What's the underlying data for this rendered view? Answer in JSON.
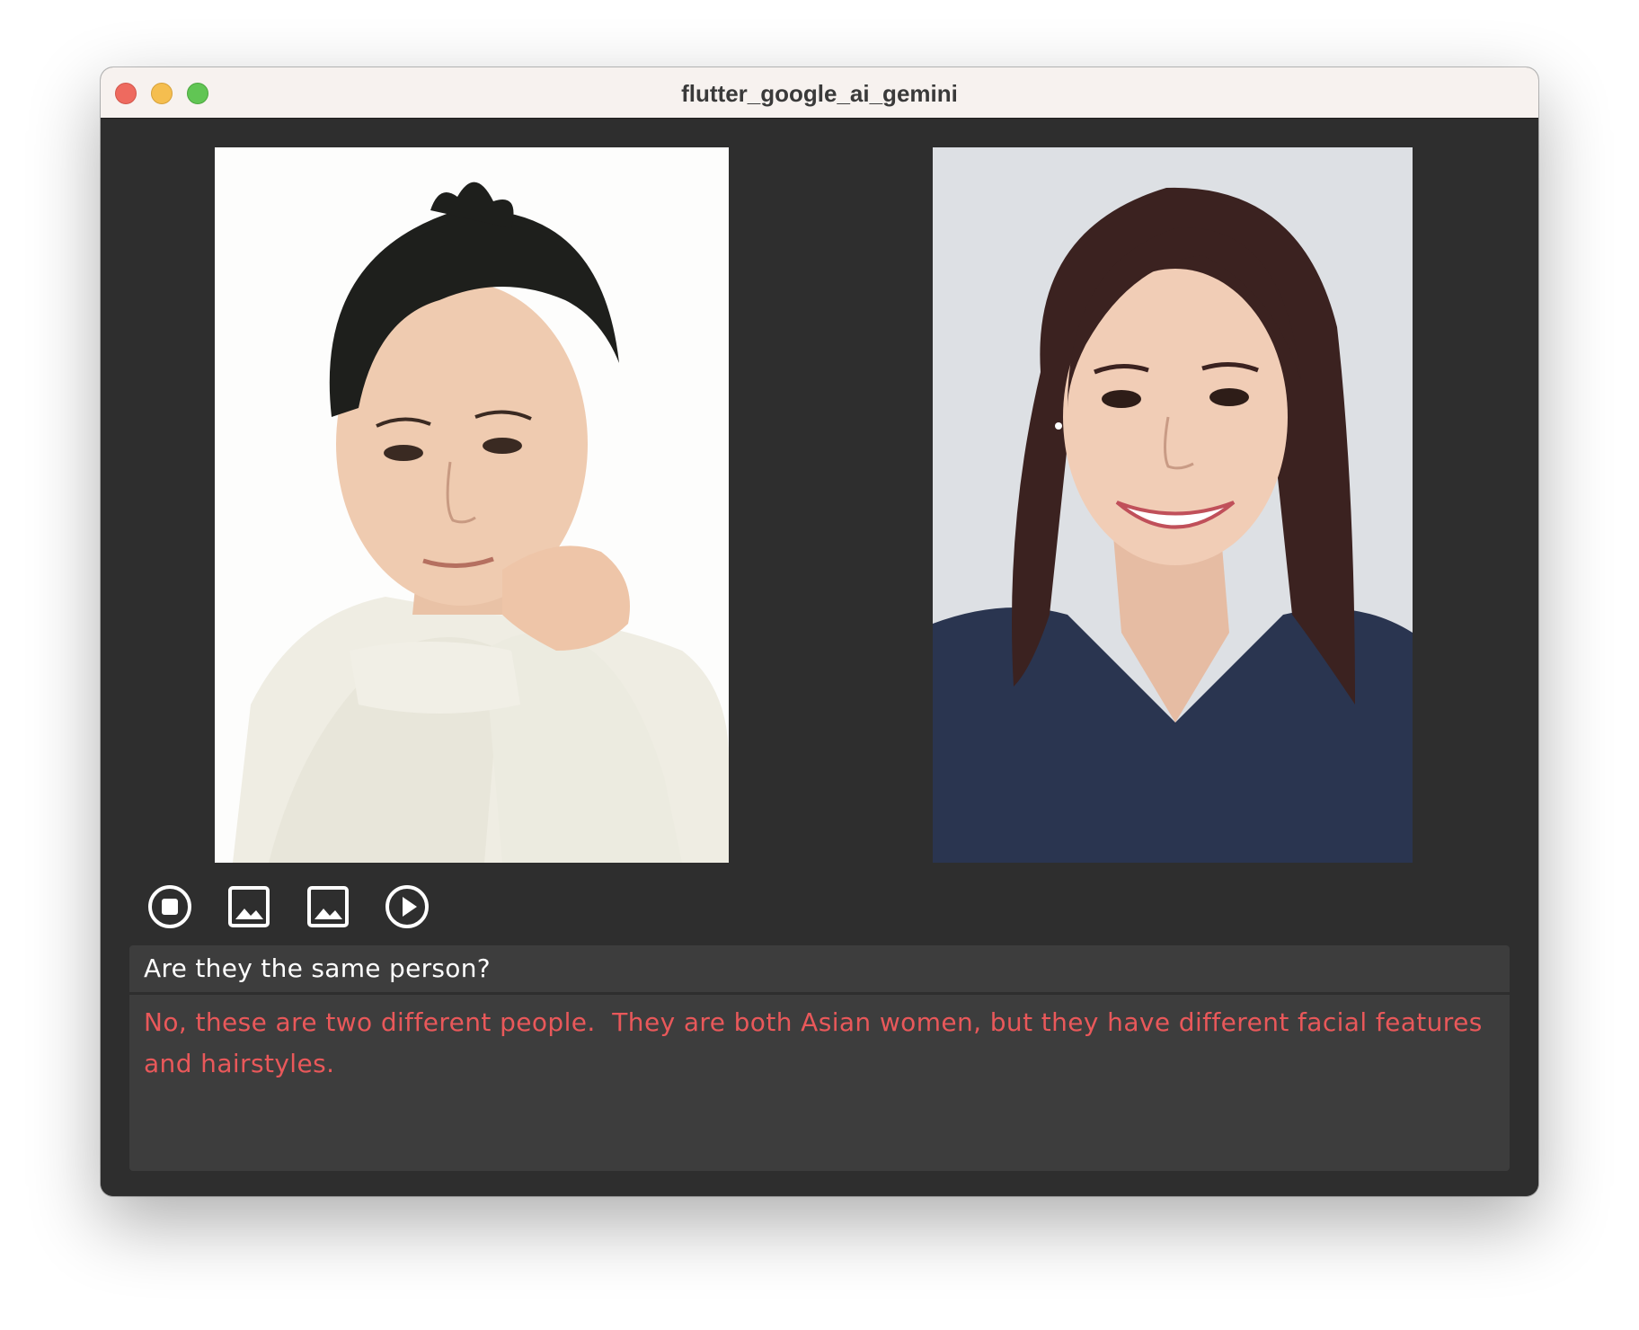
{
  "window": {
    "title": "flutter_google_ai_gemini"
  },
  "images": [
    {
      "name": "first-image",
      "description_icon": "portrait-photo-icon"
    },
    {
      "name": "second-image",
      "description_icon": "portrait-photo-icon"
    }
  ],
  "toolbar": {
    "buttons": [
      {
        "name": "stop-button",
        "icon": "stop-circle-icon"
      },
      {
        "name": "pick-image-1-button",
        "icon": "image-icon"
      },
      {
        "name": "pick-image-2-button",
        "icon": "image-icon"
      },
      {
        "name": "play-button",
        "icon": "play-circle-icon"
      }
    ]
  },
  "prompt": {
    "text": "Are they the same person?"
  },
  "response": {
    "text": "No, these are two different people.  They are both Asian women, but they have different facial features and hairstyles."
  },
  "colors": {
    "background": "#2e2e2e",
    "panel": "#3d3d3d",
    "prompt_text": "#ffffff",
    "response_text": "#e9585a",
    "titlebar": "#f7f2ef"
  }
}
